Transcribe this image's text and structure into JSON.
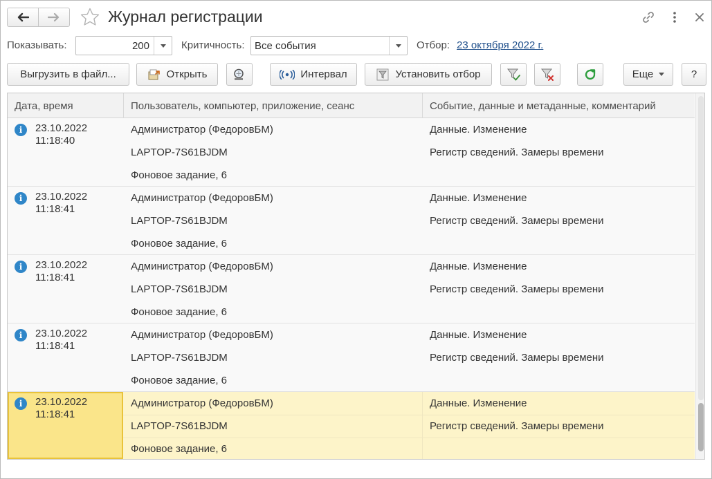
{
  "window": {
    "title": "Журнал регистрации"
  },
  "filters": {
    "show_label": "Показывать:",
    "show_value": "200",
    "level_label": "Критичность:",
    "level_value": "Все события",
    "selection_label": "Отбор:",
    "selection_value": "23 октября 2022 г."
  },
  "toolbar": {
    "export_label": "Выгрузить в файл...",
    "open_label": "Открыть",
    "interval_label": "Интервал",
    "set_filter_label": "Установить отбор",
    "more_label": "Еще",
    "help_label": "?"
  },
  "table": {
    "columns": [
      "Дата, время",
      "Пользователь, компьютер, приложение, сеанс",
      "Событие, данные и метаданные, комментарий"
    ],
    "rows": [
      {
        "date": "23.10.2022",
        "time": "11:18:40",
        "user": "Администратор (ФедоровБМ)",
        "computer": "LAPTOP-7S61BJDM",
        "app": "Фоновое задание, 6",
        "event": "Данные. Изменение",
        "metadata": "Регистр сведений. Замеры времени"
      },
      {
        "date": "23.10.2022",
        "time": "11:18:41",
        "user": "Администратор (ФедоровБМ)",
        "computer": "LAPTOP-7S61BJDM",
        "app": "Фоновое задание, 6",
        "event": "Данные. Изменение",
        "metadata": "Регистр сведений. Замеры времени"
      },
      {
        "date": "23.10.2022",
        "time": "11:18:41",
        "user": "Администратор (ФедоровБМ)",
        "computer": "LAPTOP-7S61BJDM",
        "app": "Фоновое задание, 6",
        "event": "Данные. Изменение",
        "metadata": "Регистр сведений. Замеры времени"
      },
      {
        "date": "23.10.2022",
        "time": "11:18:41",
        "user": "Администратор (ФедоровБМ)",
        "computer": "LAPTOP-7S61BJDM",
        "app": "Фоновое задание, 6",
        "event": "Данные. Изменение",
        "metadata": "Регистр сведений. Замеры времени"
      },
      {
        "date": "23.10.2022",
        "time": "11:18:41",
        "user": "Администратор (ФедоровБМ)",
        "computer": "LAPTOP-7S61BJDM",
        "app": "Фоновое задание, 6",
        "event": "Данные. Изменение",
        "metadata": "Регистр сведений. Замеры времени"
      }
    ],
    "selected_row": 4
  },
  "icons": {
    "back": "arrow-left-icon",
    "forward": "arrow-right-icon",
    "favorite": "star-icon",
    "link": "link-icon",
    "more": "kebab-icon",
    "close": "close-icon",
    "row_level": "info-icon"
  },
  "colors": {
    "selected_row": "#fdf4c9",
    "selected_cell": "#fae58a",
    "link": "#1f4f8b",
    "info_icon": "#2f86c8",
    "refresh": "#2e9e3e",
    "filter_clear": "#d0312d"
  }
}
